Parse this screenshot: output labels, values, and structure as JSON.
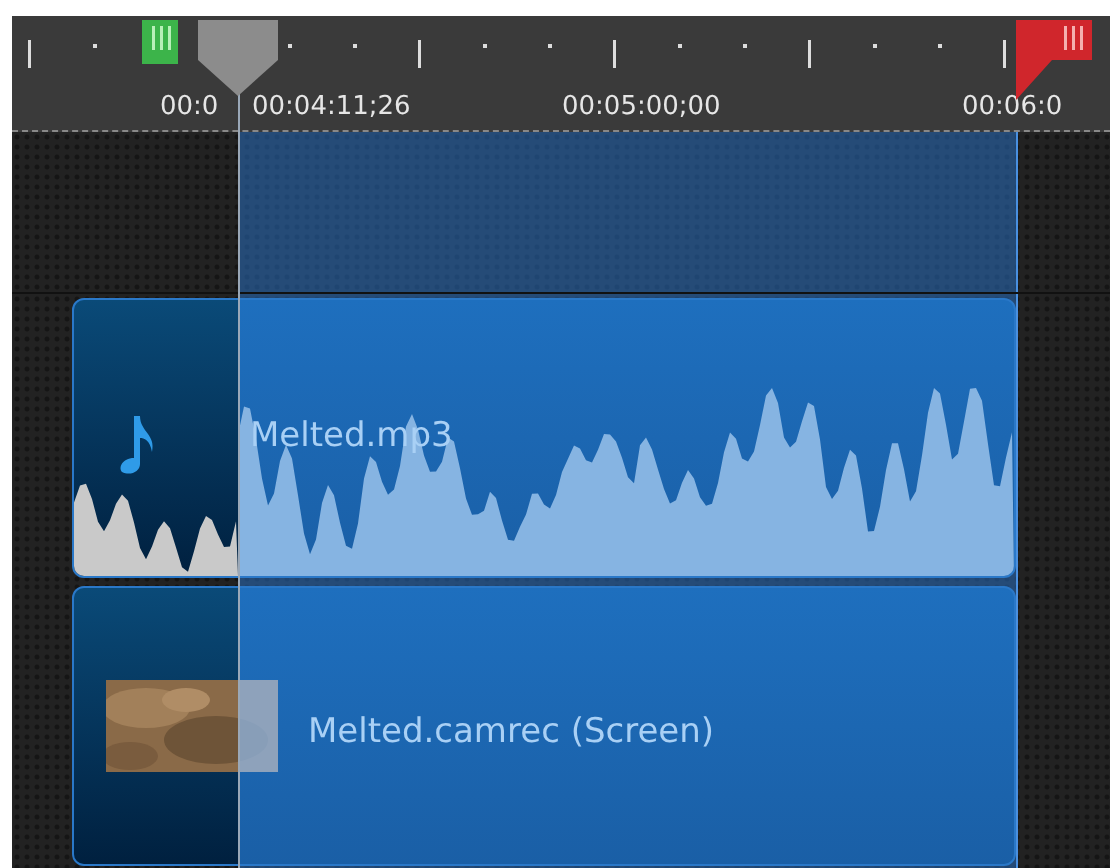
{
  "ruler": {
    "labels": [
      {
        "text": "00:0"
      },
      {
        "text": "00:04:11;26"
      },
      {
        "text": "00:05:00;00"
      },
      {
        "text": "00:06:0"
      }
    ]
  },
  "tracks": [
    {
      "kind": "empty"
    },
    {
      "kind": "audio",
      "clip": {
        "name": "Melted.mp3"
      }
    },
    {
      "kind": "video",
      "clip": {
        "name": "Melted.camrec (Screen)"
      }
    }
  ]
}
